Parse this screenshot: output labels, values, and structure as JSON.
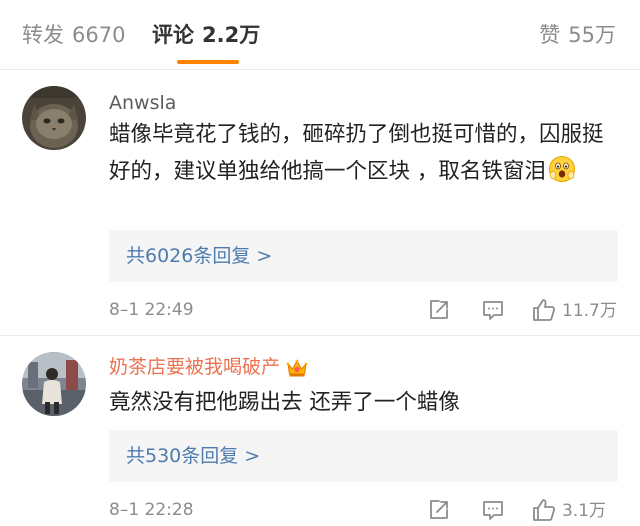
{
  "tabs": {
    "repost": {
      "label": "转发",
      "count": "6670"
    },
    "comments": {
      "label": "评论",
      "count": "2.2万"
    },
    "likes": {
      "label": "赞",
      "count": "55万"
    }
  },
  "colors": {
    "accent": "#ff8200",
    "link": "#4f7cae",
    "vip_name": "#eb7350",
    "muted": "#8c8c8c"
  },
  "comments": [
    {
      "username": "Anwsla",
      "text": "蜡像毕竟花了钱的，砸碎扔了倒也挺可惜的，囚服挺好的，建议单独给他搞一个区块 ，取名铁窗泪",
      "emoji": "scared-face-emoji",
      "replies": "共6026条回复 >",
      "time": "8–1 22:49",
      "likes": "11.7万",
      "icons": [
        "share-icon",
        "comment-icon",
        "like-icon"
      ]
    },
    {
      "username": "奶茶店要被我喝破产",
      "badge": "crown-badge-icon",
      "text": "竟然没有把他踢出去 还弄了一个蜡像",
      "replies": "共530条回复 >",
      "time": "8–1 22:28",
      "likes": "3.1万",
      "icons": [
        "share-icon",
        "comment-icon",
        "like-icon"
      ]
    }
  ]
}
